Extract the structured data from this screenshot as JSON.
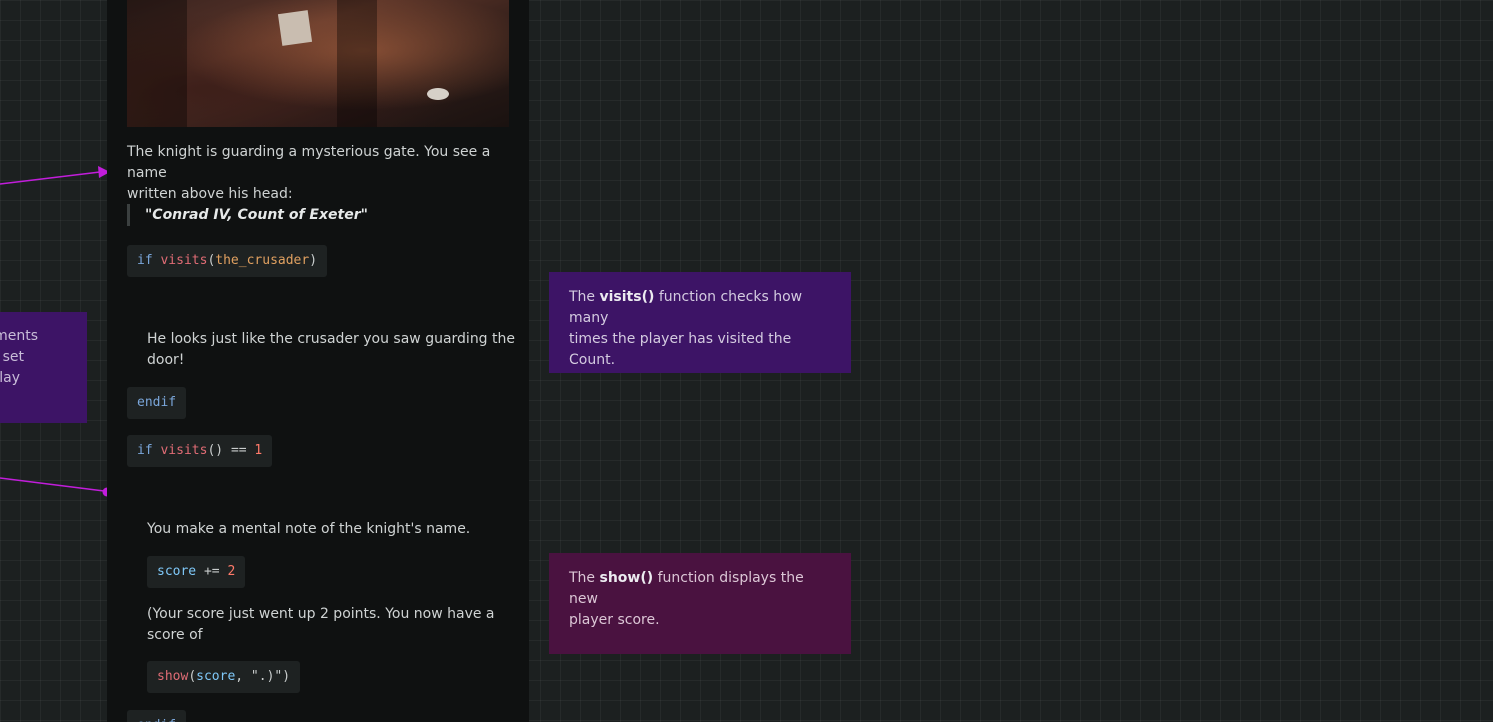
{
  "colors": {
    "canvas_bg": "#1c2020",
    "passage_bg": "#0f1111",
    "note_purple": "#3d1466",
    "note_magenta": "#4a1240",
    "connector": "#c21ddb"
  },
  "left_note": {
    "line1": "ments",
    "line2": "set",
    "line3": "lay"
  },
  "passage": {
    "image_icon": "scene-image",
    "intro_line1": "The knight is guarding a mysterious gate. You see a name",
    "intro_line2": "written above his head:",
    "quote": "\"Conrad IV, Count of Exeter\"",
    "code1": {
      "kw": "if",
      "fn": "visits",
      "open": "(",
      "arg": "the_crusader",
      "close": ")"
    },
    "looks_line1": "He looks just like the crusader you saw guarding the",
    "looks_line2": "door!",
    "endif1": "endif",
    "code2": {
      "kw": "if",
      "fn": "visits",
      "parens": "()",
      "op": "==",
      "num": "1"
    },
    "mental_note": "You make a mental note of the knight's name.",
    "code3": {
      "id": "score",
      "op": "+=",
      "num": "2"
    },
    "score_line1": "(Your score just went up 2 points. You now have a",
    "score_line2": "score of",
    "code4": {
      "fn": "show",
      "open": "(",
      "id": "score",
      "rest": ", \".)\")"
    },
    "endif2": "endif"
  },
  "notes": {
    "visits": {
      "prefix": "The ",
      "bold": "visits()",
      "line1_rest": " function checks how many",
      "line2": "times the player has visited the Count."
    },
    "show": {
      "prefix": "The ",
      "bold": "show()",
      "line1_rest": " function displays the new",
      "line2": "player score."
    }
  }
}
